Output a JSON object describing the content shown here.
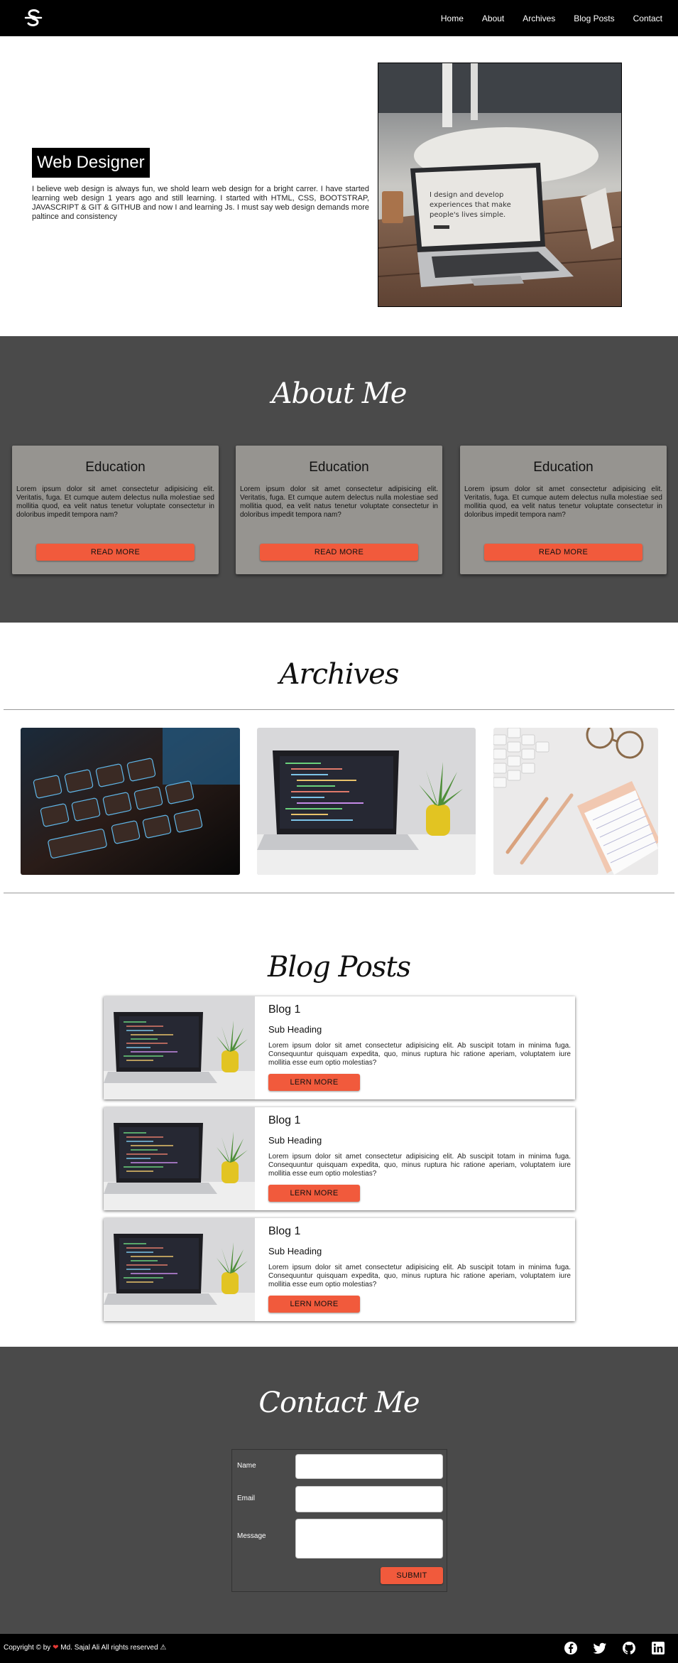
{
  "nav": {
    "logo_icon": "stylized-s-logo",
    "links": [
      "Home",
      "About",
      "Archives",
      "Blog Posts",
      "Contact"
    ]
  },
  "hero": {
    "title": "Web Designer",
    "text": "I believe web design is always fun, we shold learn web design for a bright carrer. I have started learning web design 1 years ago and still learning. I started with HTML, CSS, BOOTSTRAP, JAVASCRIPT & GIT & GITHUB and now I and learning Js. I must say web design demands more paltince and consistency",
    "screen_text_line1": "I design and develop",
    "screen_text_line2": "experiences that make",
    "screen_text_line3": "people's lives simple."
  },
  "about": {
    "title": "About Me",
    "cards": [
      {
        "title": "Education",
        "text": "Lorem ipsum dolor sit amet consectetur adipisicing elit. Veritatis, fuga. Et cumque autem delectus nulla molestiae sed mollitia quod, ea velit natus tenetur voluptate consectetur in doloribus impedit tempora nam?",
        "button": "READ MORE"
      },
      {
        "title": "Education",
        "text": "Lorem ipsum dolor sit amet consectetur adipisicing elit. Veritatis, fuga. Et cumque autem delectus nulla molestiae sed mollitia quod, ea velit natus tenetur voluptate consectetur in doloribus impedit tempora nam?",
        "button": "READ MORE"
      },
      {
        "title": "Education",
        "text": "Lorem ipsum dolor sit amet consectetur adipisicing elit. Veritatis, fuga. Et cumque autem delectus nulla molestiae sed mollitia quod, ea velit natus tenetur voluptate consectetur in doloribus impedit tempora nam?",
        "button": "READ MORE"
      }
    ]
  },
  "archives": {
    "title": "Archives"
  },
  "blog": {
    "title": "Blog Posts",
    "posts": [
      {
        "title": "Blog 1",
        "subheading": "Sub Heading",
        "text": "Lorem ipsum dolor sit amet consectetur adipisicing elit. Ab suscipit totam in minima fuga. Consequuntur quisquam expedita, quo, minus ruptura hic ratione aperiam, voluptatem iure mollitia esse eum optio molestias?",
        "button": "LERN MORE"
      },
      {
        "title": "Blog 1",
        "subheading": "Sub Heading",
        "text": "Lorem ipsum dolor sit amet consectetur adipisicing elit. Ab suscipit totam in minima fuga. Consequuntur quisquam expedita, quo, minus ruptura hic ratione aperiam, voluptatem iure mollitia esse eum optio molestias?",
        "button": "LERN MORE"
      },
      {
        "title": "Blog 1",
        "subheading": "Sub Heading",
        "text": "Lorem ipsum dolor sit amet consectetur adipisicing elit. Ab suscipit totam in minima fuga. Consequuntur quisquam expedita, quo, minus ruptura hic ratione aperiam, voluptatem iure mollitia esse eum optio molestias?",
        "button": "LERN MORE"
      }
    ]
  },
  "contact": {
    "title": "Contact Me",
    "name_label": "Name",
    "email_label": "Email",
    "message_label": "Message",
    "submit": "SUBMIT"
  },
  "footer": {
    "copyright_prefix": "Copyright © by",
    "copyright_suffix": "Md. Sajal Ali All rights reserved",
    "social_icons": [
      "facebook-icon",
      "twitter-icon",
      "github-icon",
      "linkedin-icon"
    ]
  },
  "colors": {
    "accent": "#f15a3c",
    "dark_section": "#4a4a4a",
    "card_bg": "#969490",
    "nav_bg": "#000000"
  }
}
